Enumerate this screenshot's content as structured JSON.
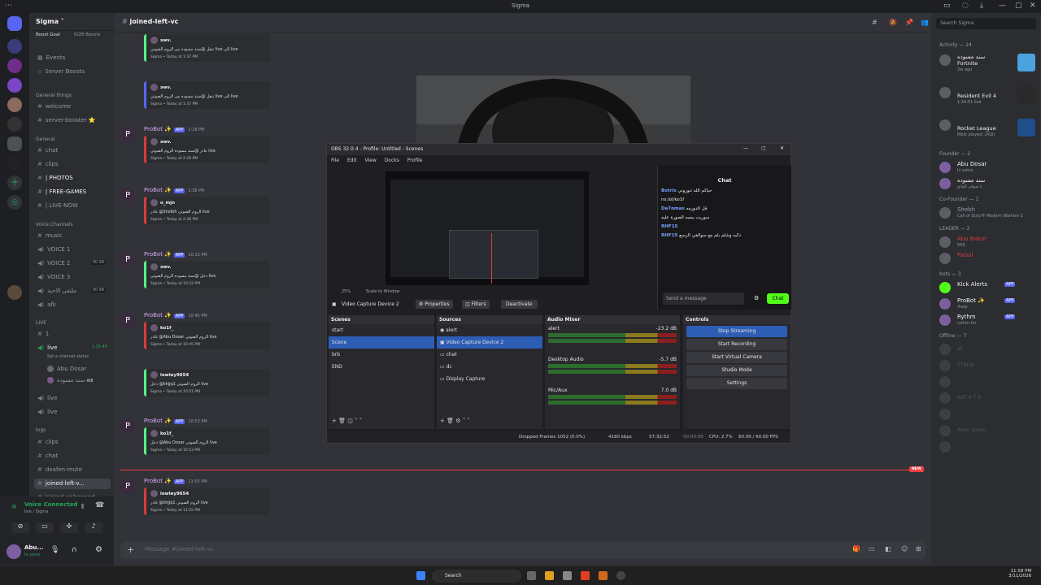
{
  "titlebar": {
    "title": "Sigma"
  },
  "server": {
    "name": "Sigma",
    "boost_goal": "Boost Goal",
    "boosts": "0/28 Boosts",
    "links": [
      "Events",
      "Server Boosts"
    ]
  },
  "channels": {
    "cat_general_things": "General things",
    "general_things": [
      "welcome",
      "server-booster"
    ],
    "cat_general": "General",
    "general": [
      "chat",
      "clips",
      "PHOTOS",
      "FREE-GAMES",
      "LIVE-NOW"
    ],
    "cat_voice": "Voice Channels",
    "voice": [
      "music",
      "VOICE 1",
      "VOICE 2",
      "VOICE 3",
      "ملتقى الاحبة",
      "afk"
    ],
    "voice_counts": {
      "voice2": "00 99",
      "lounge": "00 99"
    },
    "cat_live": "LIVE",
    "live": [
      "1",
      "live"
    ],
    "live_time": "1:35:49",
    "live_status": "Set a channel status",
    "live_users": [
      "Abu Dosar",
      "سند مسوده"
    ],
    "live_user_tag": "AI8",
    "live_more": [
      "live",
      "live"
    ],
    "cat_logs": "logs",
    "logs": [
      "clips",
      "chat",
      "deafen-mute",
      "joined-left-v...",
      "kicked-or-banned"
    ]
  },
  "voice_panel": {
    "status": "Voice Connected",
    "channel": "live / Sigma"
  },
  "user_panel": {
    "name": "Abu...",
    "status": "In voice"
  },
  "chat": {
    "channel_name": "joined-left-vc",
    "composer_placeholder": "Message #joined-left-vc",
    "new_label": "NEW",
    "messages": [
      {
        "id": "m0",
        "author": "",
        "time": "",
        "embed_user": "эwv.",
        "embed_text": "تنقل @سند مسوده من الروم الصوتي live  الى live",
        "footer": "Sigma • Today at 1:37 PM",
        "color": "g"
      },
      {
        "id": "m1",
        "author": "",
        "time": "",
        "embed_user": "эwv.",
        "embed_text": "تنقل @سند مسوده من الروم الصوتي live  الى live",
        "footer": "Sigma • Today at 1:37 PM",
        "color": "b"
      },
      {
        "id": "m2",
        "author": "ProBot ✨",
        "app": "APP",
        "time": "2:28 PM",
        "embed_user": "эwv.",
        "embed_text": "غادر @سند مسوده الروم الصوتي live",
        "footer": "Sigma • Today at 2:28 PM",
        "color": "r"
      },
      {
        "id": "m3",
        "author": "ProBot ✨",
        "app": "APP",
        "time": "2:38 PM",
        "embed_user": "o_mjn",
        "embed_text": "غادر @Shelbh الروم الصوتي live",
        "footer": "Sigma • Today at 2:38 PM",
        "color": "r"
      },
      {
        "id": "m4",
        "author": "ProBot ✨",
        "app": "APP",
        "time": "10:22 PM",
        "embed_user": "эwv.",
        "embed_text": "دخل @سند مسوده الروم الصوتي live",
        "footer": "Sigma • Today at 10:22 PM",
        "color": "g"
      },
      {
        "id": "m5",
        "author": "ProBot ✨",
        "app": "APP",
        "time": "10:45 PM",
        "embed_user": "ko1f_",
        "embed_text": "غادر @Abu Dosar الروم الصوتي live",
        "footer": "Sigma • Today at 10:45 PM",
        "color": "r"
      },
      {
        "id": "m6",
        "author": "",
        "time": "",
        "embed_user": "lowley9654",
        "embed_text": "دخل @khjjq1 الروم الصوتي live",
        "footer": "Sigma • Today at 10:51 PM",
        "color": "g"
      },
      {
        "id": "m7",
        "author": "ProBot ✨",
        "app": "APP",
        "time": "10:53 PM",
        "embed_user": "ko1f_",
        "embed_text": "دخل @Abu Dosar الروم الصوتي live",
        "footer": "Sigma • Today at 10:53 PM",
        "color": "g"
      },
      {
        "id": "m8",
        "author": "ProBot ✨",
        "app": "APP",
        "time": "11:55 PM",
        "embed_user": "lowley9654",
        "embed_text": "غادر @khjjq1 الروم الصوتي live",
        "footer": "Sigma • Today at 11:55 PM",
        "color": "r"
      }
    ]
  },
  "members": {
    "search_placeholder": "Search Sigma",
    "activity": "Activity — 24",
    "activities": [
      {
        "name": "سند مسوده",
        "game": "Fortnite",
        "status": "2w ago"
      },
      {
        "name": "",
        "game": "Resident Evil 4",
        "status": "1:34:51 live"
      },
      {
        "name": "",
        "game": "Rocket League",
        "status": "Most played: 242h"
      }
    ],
    "founder": "Founder — 2",
    "founders": [
      {
        "name": "Abu Dosar",
        "status": "In voice"
      },
      {
        "name": "سند مسوده",
        "status": "يا شوقي الفاتح"
      }
    ],
    "cofounder": "Co-Founder — 1",
    "cofounders": [
      {
        "name": "Shebh",
        "status": "Call of Duty® Modern Warfare 3"
      }
    ],
    "leader": "LEADER — 2",
    "leaders": [
      {
        "name": "Abu Bakar",
        "status": "569"
      },
      {
        "name": "Faisal",
        "status": ""
      }
    ],
    "bots": "bots — 3",
    "botlist": [
      {
        "name": "Kick Alerts",
        "app": "APP",
        "status": ""
      },
      {
        "name": "ProBot ✨",
        "app": "APP",
        "status": "/help"
      },
      {
        "name": "Rythm",
        "app": "APP",
        "status": "rythm.fm"
      }
    ],
    "offline": "Offline — 7",
    "offline_names": [
      "ef",
      "STREW",
      "",
      "NAT A T S",
      "",
      "Abdo Soesil",
      ""
    ]
  },
  "obs": {
    "title": "OBS 32.0.4 - Profile: Untitled - Scenes",
    "menu": [
      "File",
      "Edit",
      "View",
      "Docks",
      "Profile"
    ],
    "zoom": "25%",
    "scale": "Scale to Window",
    "source_label": "Video Capture Device 2",
    "properties": "Properties",
    "filters": "Filters",
    "deactivate": "Deactivate",
    "scenes_title": "Scenes",
    "scenes": [
      "start",
      "Scene",
      "brb",
      "END"
    ],
    "sources_title": "Sources",
    "sources": [
      "alert",
      "Video Capture Device 2",
      "chat",
      "dc",
      "Display Capture"
    ],
    "mixer_title": "Audio Mixer",
    "mixer": [
      {
        "name": "alert",
        "db": "-23.2 dB"
      },
      {
        "name": "Desktop Audio",
        "db": "-5.7 dB"
      },
      {
        "name": "Mic/Aux",
        "db": "7.0 dB"
      }
    ],
    "controls_title": "Controls",
    "controls": [
      "Stop Streaming",
      "Start Recording",
      "Start Virtual Camera",
      "Studio Mode",
      "Settings"
    ],
    "status": {
      "dropped": "Dropped Frames 1052 (0.0%)",
      "kbps": "4190 kbps",
      "live_time": "57:32:52",
      "rec_time": "00:00:00",
      "cpu": "CPU: 2.7%",
      "fps": "60.00 / 60.00 FPS"
    }
  },
  "chatpop": {
    "title": "Chat",
    "lines": [
      {
        "user": "Botrix",
        "text": "حياكم الله تنوروني"
      },
      {
        "user": "",
        "text": "ns.lol/ko1f"
      },
      {
        "user": "Da7omax",
        "text": "قل الدورمه"
      },
      {
        "user": "",
        "text": "سوريت بسبه الصورة عليه"
      },
      {
        "user": "RHF1S",
        "text": ""
      },
      {
        "user": "RHF1S",
        "text": "دكيه وشلم بلم مع سوالفي الرسع"
      }
    ],
    "placeholder": "Send a message",
    "button": "Chat"
  },
  "taskbar": {
    "search": "Search",
    "time": "11:58 PM",
    "date": "3/11/2026"
  }
}
